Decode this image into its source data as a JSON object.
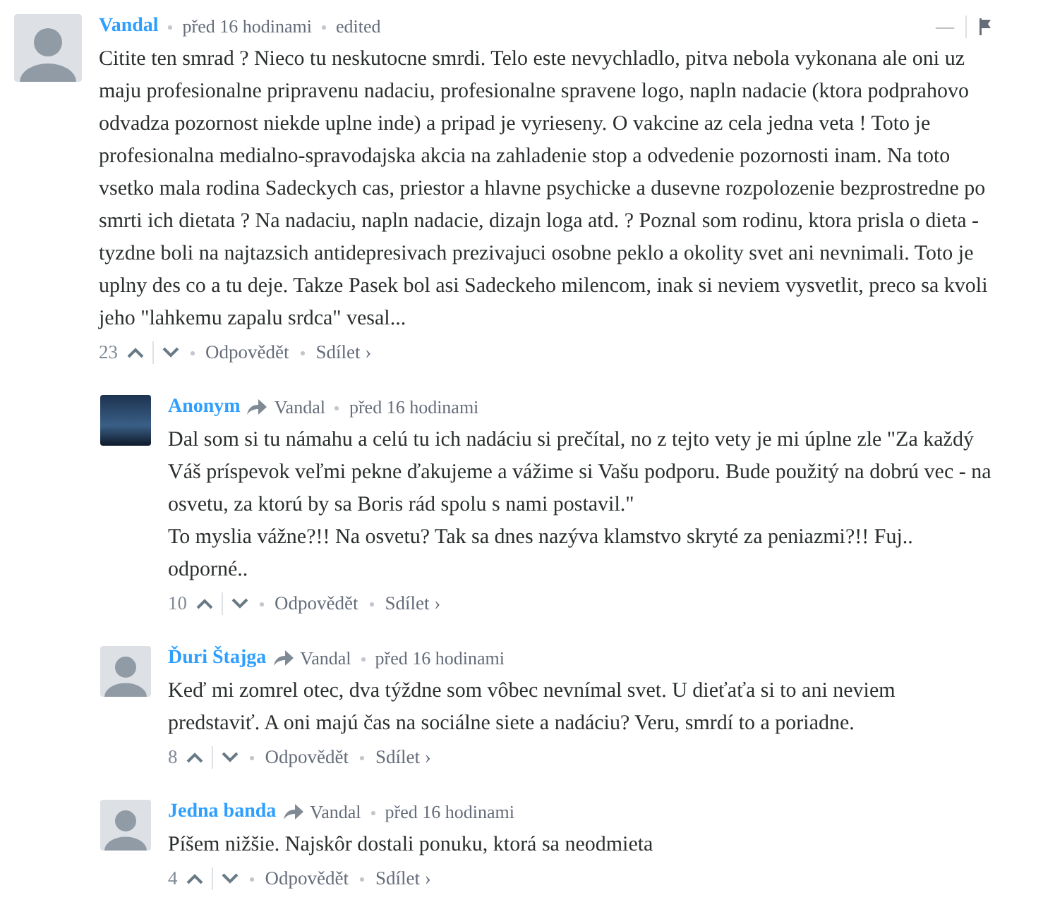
{
  "comments": [
    {
      "author": "Vandal",
      "avatar_photo": false,
      "time": "před 16 hodinami",
      "edited": "edited",
      "paragraphs": [
        "Citite ten smrad ? Nieco tu neskutocne smrdi. Telo este nevychladlo, pitva nebola vykonana ale oni uz maju profesionalne pripravenu nadaciu, profesionalne spravene logo, napln nadacie (ktora podprahovo odvadza pozornost niekde uplne inde) a pripad je vyrieseny. O vakcine az cela jedna veta ! Toto je profesionalna medialno-spravodajska akcia na zahladenie stop a odvedenie pozornosti inam. Na toto vsetko mala rodina Sadeckych cas, priestor a hlavne psychicke a dusevne rozpolozenie bezprostredne po smrti ich dietata ? Na nadaciu, napln nadacie, dizajn loga atd. ? Poznal som rodinu, ktora prisla o dieta - tyzdne boli na najtazsich antidepresivach prezivajuci osobne peklo a okolity svet ani nevnimali. Toto je uplny des co a tu deje. Takze Pasek bol asi Sadeckeho milencom, inak si neviem vysvetlit, preco sa kvoli jeho \"lahkemu zapalu srdca\" vesal..."
      ],
      "votes": "23",
      "reply": "Odpovědět",
      "share": "Sdílet ›",
      "collapse": "—",
      "children": [
        {
          "author": "Anonym",
          "avatar_photo": true,
          "reply_to": "Vandal",
          "time": "před 16 hodinami",
          "paragraphs": [
            "Dal som si tu námahu a celú tu ich nadáciu si prečítal, no z tejto vety je mi úplne zle \"Za každý Váš príspevok veľmi pekne ďakujeme a vážime si Vašu podporu. Bude použitý na dobrú vec - na osvetu, za ktorú by sa Boris rád spolu s nami postavil.\"",
            "To myslia vážne?!! Na osvetu? Tak sa dnes nazýva klamstvo skryté za peniazmi?!! Fuj.. odporné.."
          ],
          "votes": "10",
          "reply": "Odpovědět",
          "share": "Sdílet ›"
        },
        {
          "author": "Ďuri Štajga",
          "avatar_photo": false,
          "reply_to": "Vandal",
          "time": "před 16 hodinami",
          "paragraphs": [
            "Keď mi zomrel otec, dva týždne som vôbec nevnímal svet. U dieťaťa si to ani neviem predstaviť. A oni majú čas na sociálne siete a nadáciu? Veru, smrdí to a poriadne."
          ],
          "votes": "8",
          "reply": "Odpovědět",
          "share": "Sdílet ›"
        },
        {
          "author": "Jedna banda",
          "avatar_photo": false,
          "reply_to": "Vandal",
          "time": "před 16 hodinami",
          "paragraphs": [
            "Píšem nižšie. Najskôr dostali ponuku, ktorá sa neodmieta"
          ],
          "votes": "4",
          "reply": "Odpovědět",
          "share": "Sdílet ›"
        }
      ]
    }
  ]
}
